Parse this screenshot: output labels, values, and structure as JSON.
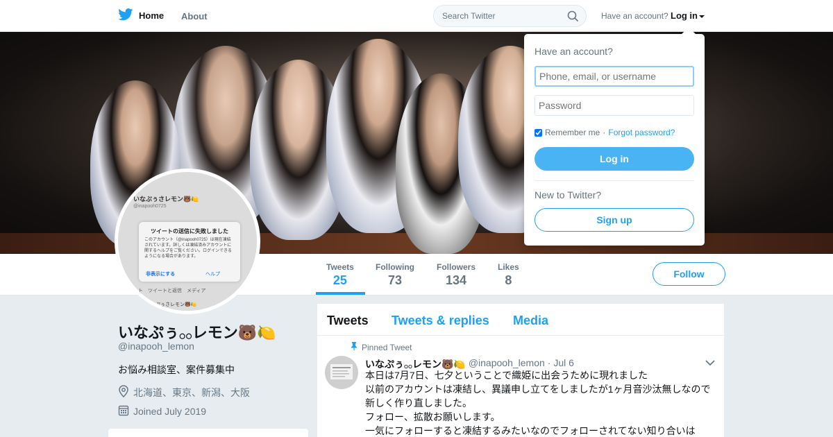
{
  "nav": {
    "home_label": "Home",
    "about_label": "About",
    "search_placeholder": "Search Twitter",
    "have_account": "Have an account?",
    "login_label": "Log in",
    "brand_color": "#1da1f2"
  },
  "stats": [
    {
      "label": "Tweets",
      "value": "25",
      "active": true
    },
    {
      "label": "Following",
      "value": "73",
      "active": false
    },
    {
      "label": "Followers",
      "value": "134",
      "active": false
    },
    {
      "label": "Likes",
      "value": "8",
      "active": false
    }
  ],
  "follow_label": "Follow",
  "avatar": {
    "title": "いなぷぅさレモン🐻🍋",
    "handle": "@inapooh0725",
    "dialog_title": "ツイートの送信に失敗しました",
    "dialog_body": "このアカウント（@inapooh0725）は現在凍結されています。詳しくは凍結済みアカウントに関するヘルプをご覧ください。ログインできるようになる場合があります。",
    "dialog_btn_hide": "非表示にする",
    "dialog_btn_help": "ヘルプ",
    "tabs": "ート　ツイートと返信　メディア",
    "footer": "いなぷぅさレモン🐻🍋"
  },
  "profile": {
    "name": "いなぷぅ𓂂𓂂レモン🐻🍋",
    "handle": "@inapooh_lemon",
    "bio": "お悩み相談室、案件募集中",
    "location": "北海道、東京、新潟、大阪",
    "joined": "Joined July 2019"
  },
  "timeline": {
    "tabs": [
      "Tweets",
      "Tweets & replies",
      "Media"
    ],
    "pinned_label": "Pinned Tweet",
    "tweet": {
      "name": "いなぷぅ𓂂𓂂レモン🐻🍋",
      "handle": "@inapooh_lemon",
      "date": "· Jul 6",
      "lines": [
        "本日は7月7日、七夕ということで織姫に出会うために現れました",
        "以前のアカウントは凍結し、異議申し立てをしましたが1ヶ月音沙汰無しなので新しく作り直しました。",
        "フォロー、拡散お願いします。",
        "一気にフォローすると凍結するみたいなのでフォローされてない知り合いは"
      ]
    }
  },
  "login_dropdown": {
    "question": "Have an account?",
    "username_placeholder": "Phone, email, or username",
    "password_placeholder": "Password",
    "remember_label": "Remember me",
    "separator": "·",
    "forgot_label": "Forgot password?",
    "login_button": "Log in",
    "new_label": "New to Twitter?",
    "signup_button": "Sign up"
  }
}
